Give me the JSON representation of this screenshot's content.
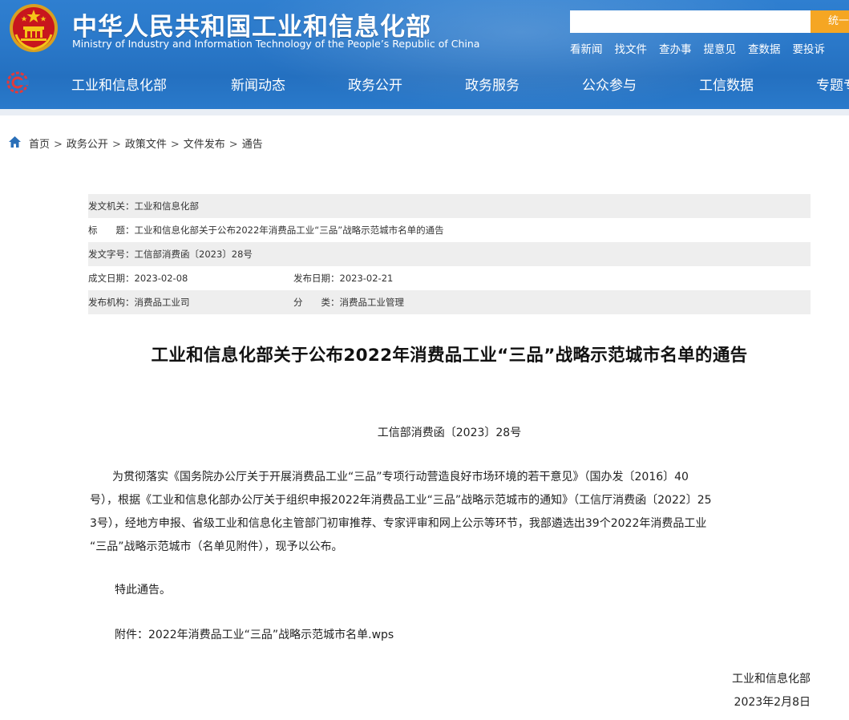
{
  "header": {
    "title": "中华人民共和国工业和信息化部",
    "subtitle": "Ministry of Industry and Information Technology of the People’s Republic of China",
    "search_placeholder": "",
    "search_button": "统一",
    "quick_links": [
      "看新闻",
      "找文件",
      "查办事",
      "提意见",
      "查数据",
      "要投诉"
    ],
    "nav": [
      "工业和信息化部",
      "新闻动态",
      "政务公开",
      "政务服务",
      "公众参与",
      "工信数据",
      "专题专"
    ]
  },
  "breadcrumb": [
    "首页",
    "政务公开",
    "政策文件",
    "文件发布",
    "通告"
  ],
  "info": {
    "issuer": "发文机关：工业和信息化部",
    "title": "标　　题：工业和信息化部关于公布2022年消费品工业“三品”战略示范城市名单的通告",
    "doc_number": "发文字号：工信部消费函〔2023〕28号",
    "created_date": "成文日期：2023-02-08",
    "published_date": "发布日期：2023-02-21",
    "agency": "发布机构：消费品工业司",
    "category": "分　　类：消费品工业管理"
  },
  "article": {
    "title": "工业和信息化部关于公布2022年消费品工业“三品”战略示范城市名单的通告",
    "doc_number": "工信部消费函〔2023〕28号",
    "paragraph_lines": [
      "　　为贯彻落实《国务院办公厅关于开展消费品工业“三品”专项行动营造良好市场环境的若干意见》（国办发〔2016〕40",
      "号），根据《工业和信息化部办公厅关于组织申报2022年消费品工业“三品”战略示范城市的通知》（工信厅消费函〔2022〕25",
      "3号），经地方申报、省级工业和信息化主管部门初审推荐、专家评审和网上公示等环节，我部遴选出39个2022年消费品工业",
      "“三品”战略示范城市（名单见附件），现予以公布。"
    ],
    "notice": "特此通告。",
    "attachment": "附件：2022年消费品工业“三品”战略示范城市名单.wps",
    "signature_org": "工业和信息化部",
    "signature_date": "2023年2月8日"
  }
}
